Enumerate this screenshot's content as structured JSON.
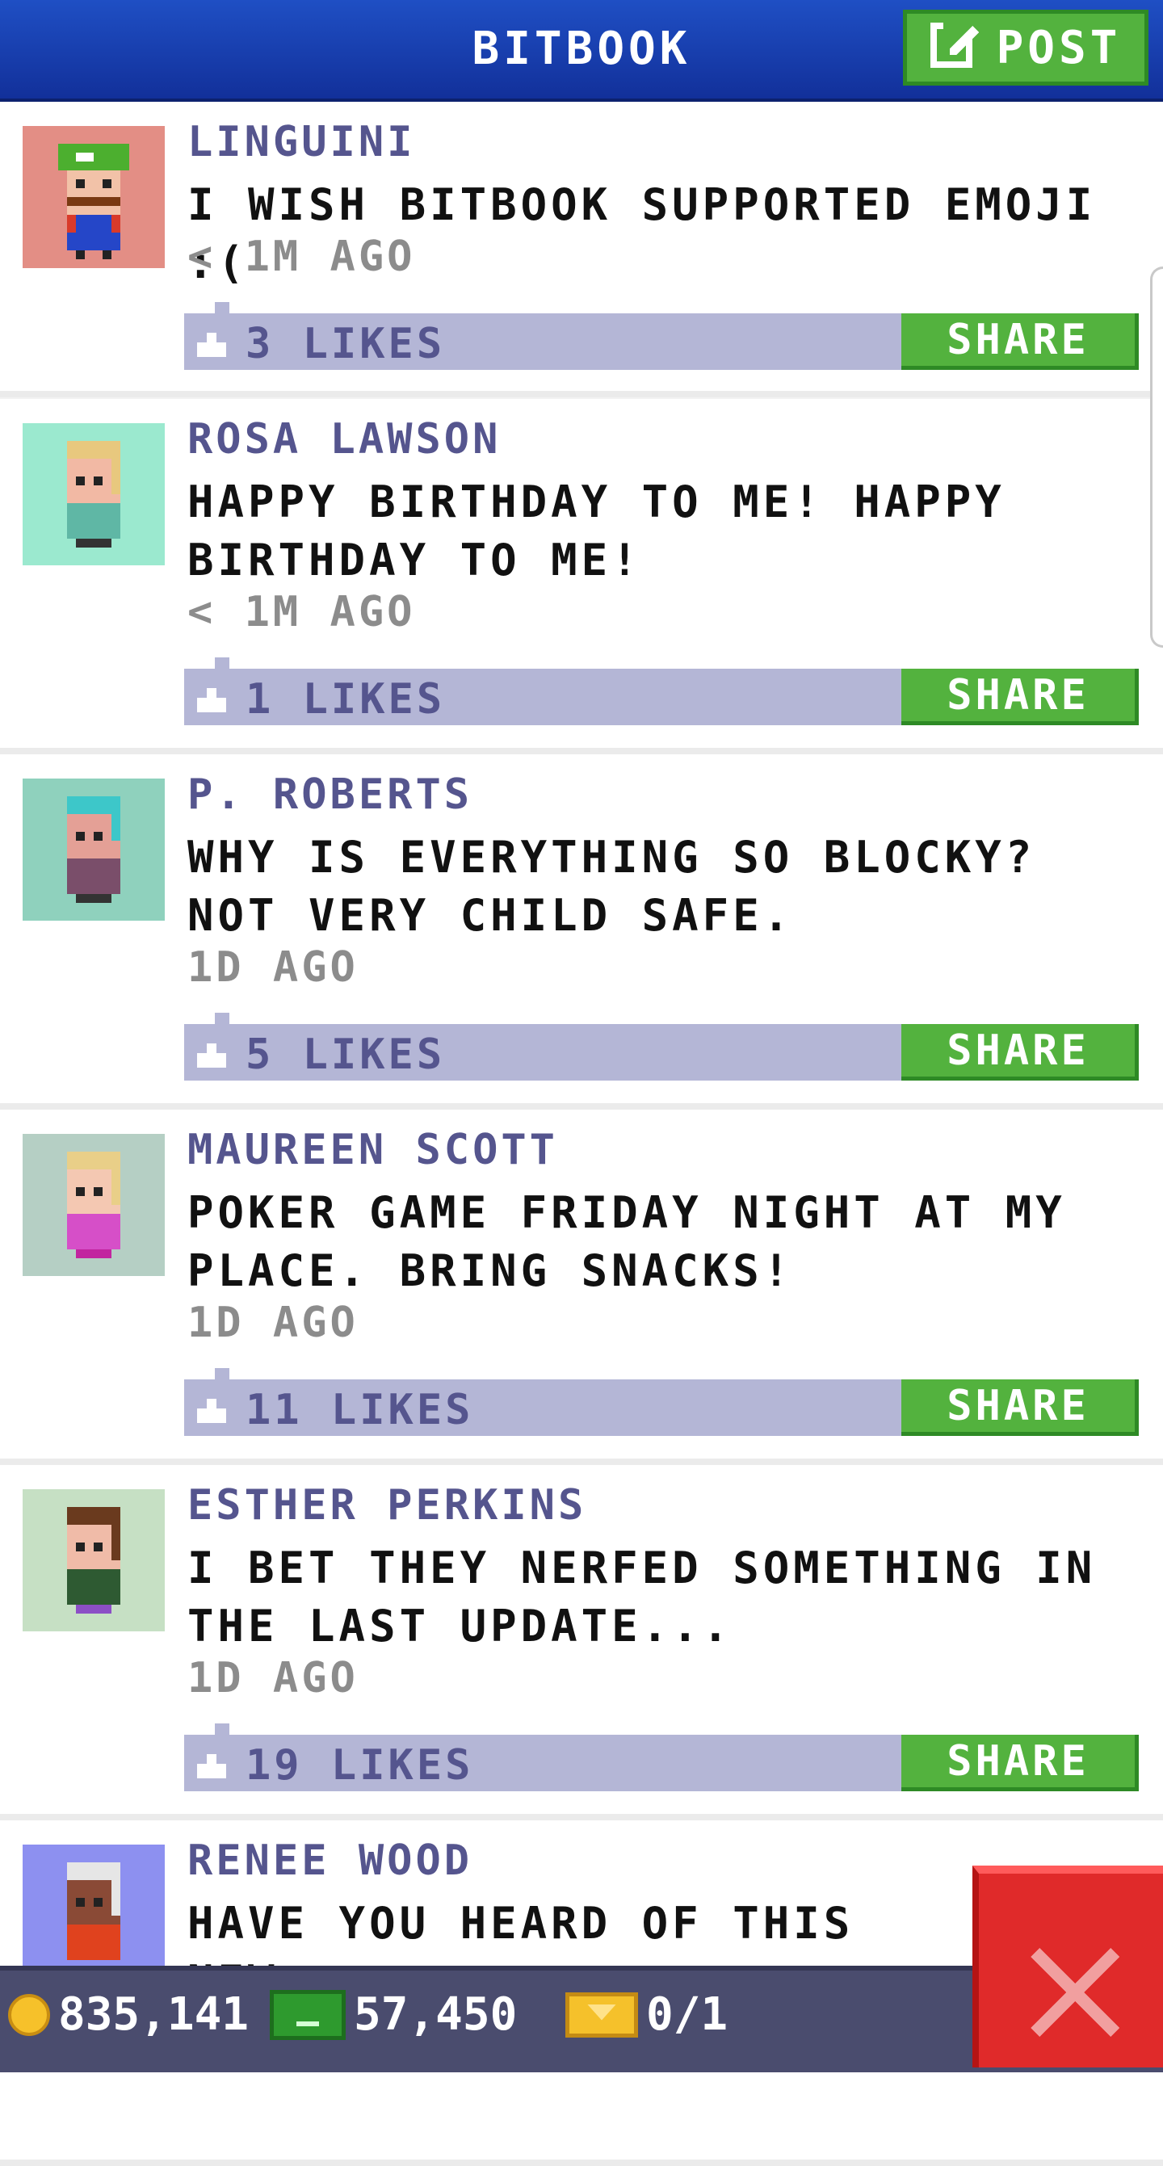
{
  "header": {
    "title": "BITBOOK",
    "post_label": "POST"
  },
  "posts": [
    {
      "author": "LINGUINI",
      "message": "I WISH BITBOOK SUPPORTED EMOJI :(",
      "time": "< 1M AGO",
      "likes": "3 LIKES",
      "share_label": "SHARE",
      "avatar_bg": "#e38e85"
    },
    {
      "author": "ROSA LAWSON",
      "message": "HAPPY BIRTHDAY TO ME! HAPPY BIRTHDAY TO ME!",
      "time": "< 1M AGO",
      "likes": "1 LIKES",
      "share_label": "SHARE",
      "avatar_bg": "#9be9cf"
    },
    {
      "author": "P. ROBERTS",
      "message": "WHY IS EVERYTHING SO BLOCKY? NOT VERY CHILD SAFE.",
      "time": "1D AGO",
      "likes": "5 LIKES",
      "share_label": "SHARE",
      "avatar_bg": "#8fd1bd"
    },
    {
      "author": "MAUREEN SCOTT",
      "message": "POKER GAME FRIDAY NIGHT AT MY PLACE. BRING SNACKS!",
      "time": "1D AGO",
      "likes": "11 LIKES",
      "share_label": "SHARE",
      "avatar_bg": "#b5cfc4"
    },
    {
      "author": "ESTHER PERKINS",
      "message": "I BET THEY NERFED SOMETHING IN THE LAST UPDATE...",
      "time": "1D AGO",
      "likes": "19 LIKES",
      "share_label": "SHARE",
      "avatar_bg": "#c6e0c4"
    },
    {
      "author": "RENEE WOOD",
      "message": "HAVE YOU HEARD OF THIS NEW",
      "avatar_bg": "#8d90f0"
    }
  ],
  "status": {
    "coins": "835,141",
    "bux": "57,450",
    "vip": "0/1"
  },
  "colors": {
    "header": "#1a3fb5",
    "button_green": "#53b23e",
    "likes_bar": "#b4b6d6",
    "author_text": "#55558e",
    "close_red": "#e02a2a"
  },
  "icons": [
    "post-edit-icon",
    "like-icon",
    "coin-icon",
    "bux-icon",
    "vip-icon",
    "close-icon"
  ]
}
